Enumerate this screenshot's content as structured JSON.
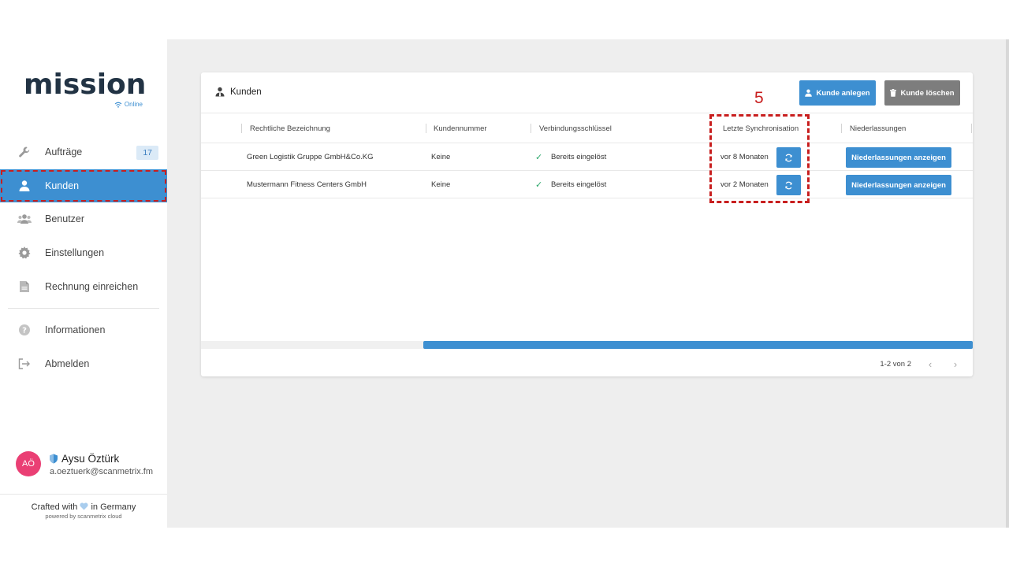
{
  "sidebar": {
    "logo": "mission",
    "status": "Online",
    "nav": [
      {
        "label": "Aufträge",
        "icon": "wrench-icon",
        "badge": "17"
      },
      {
        "label": "Kunden",
        "icon": "customer-icon",
        "active": true
      },
      {
        "label": "Benutzer",
        "icon": "users-icon"
      },
      {
        "label": "Einstellungen",
        "icon": "gear-icon"
      },
      {
        "label": "Rechnung einreichen",
        "icon": "document-icon"
      },
      {
        "label": "Informationen",
        "icon": "help-icon"
      },
      {
        "label": "Abmelden",
        "icon": "logout-icon"
      }
    ],
    "user": {
      "initials": "AÖ",
      "name": "Aysu Öztürk",
      "email": "a.oeztuerk@scanmetrix.fm"
    },
    "footer": {
      "crafted_prefix": "Crafted with",
      "crafted_suffix": "in Germany",
      "powered": "powered by scanmetrix cloud"
    }
  },
  "card": {
    "title": "Kunden",
    "add_button": "Kunde anlegen",
    "delete_button": "Kunde löschen",
    "columns": [
      "Rechtliche Bezeichnung",
      "Kundennummer",
      "Verbindungsschlüssel",
      "Letzte Synchronisation",
      "Niederlassungen"
    ],
    "rows": [
      {
        "name": "Green Logistik Gruppe GmbH&Co.KG",
        "number": "Keine",
        "key": "Bereits eingelöst",
        "sync": "vor 8 Monaten",
        "branch_button": "Niederlassungen anzeigen"
      },
      {
        "name": "Mustermann Fitness Centers GmbH",
        "number": "Keine",
        "key": "Bereits eingelöst",
        "sync": "vor 2 Monaten",
        "branch_button": "Niederlassungen anzeigen"
      }
    ],
    "pagination": "1-2 von 2"
  },
  "annotation": {
    "number": "5"
  },
  "colors": {
    "accent": "#3d8fd1",
    "highlight": "#c81e1e",
    "avatar": "#ea3f74",
    "check": "#2aa76a"
  }
}
